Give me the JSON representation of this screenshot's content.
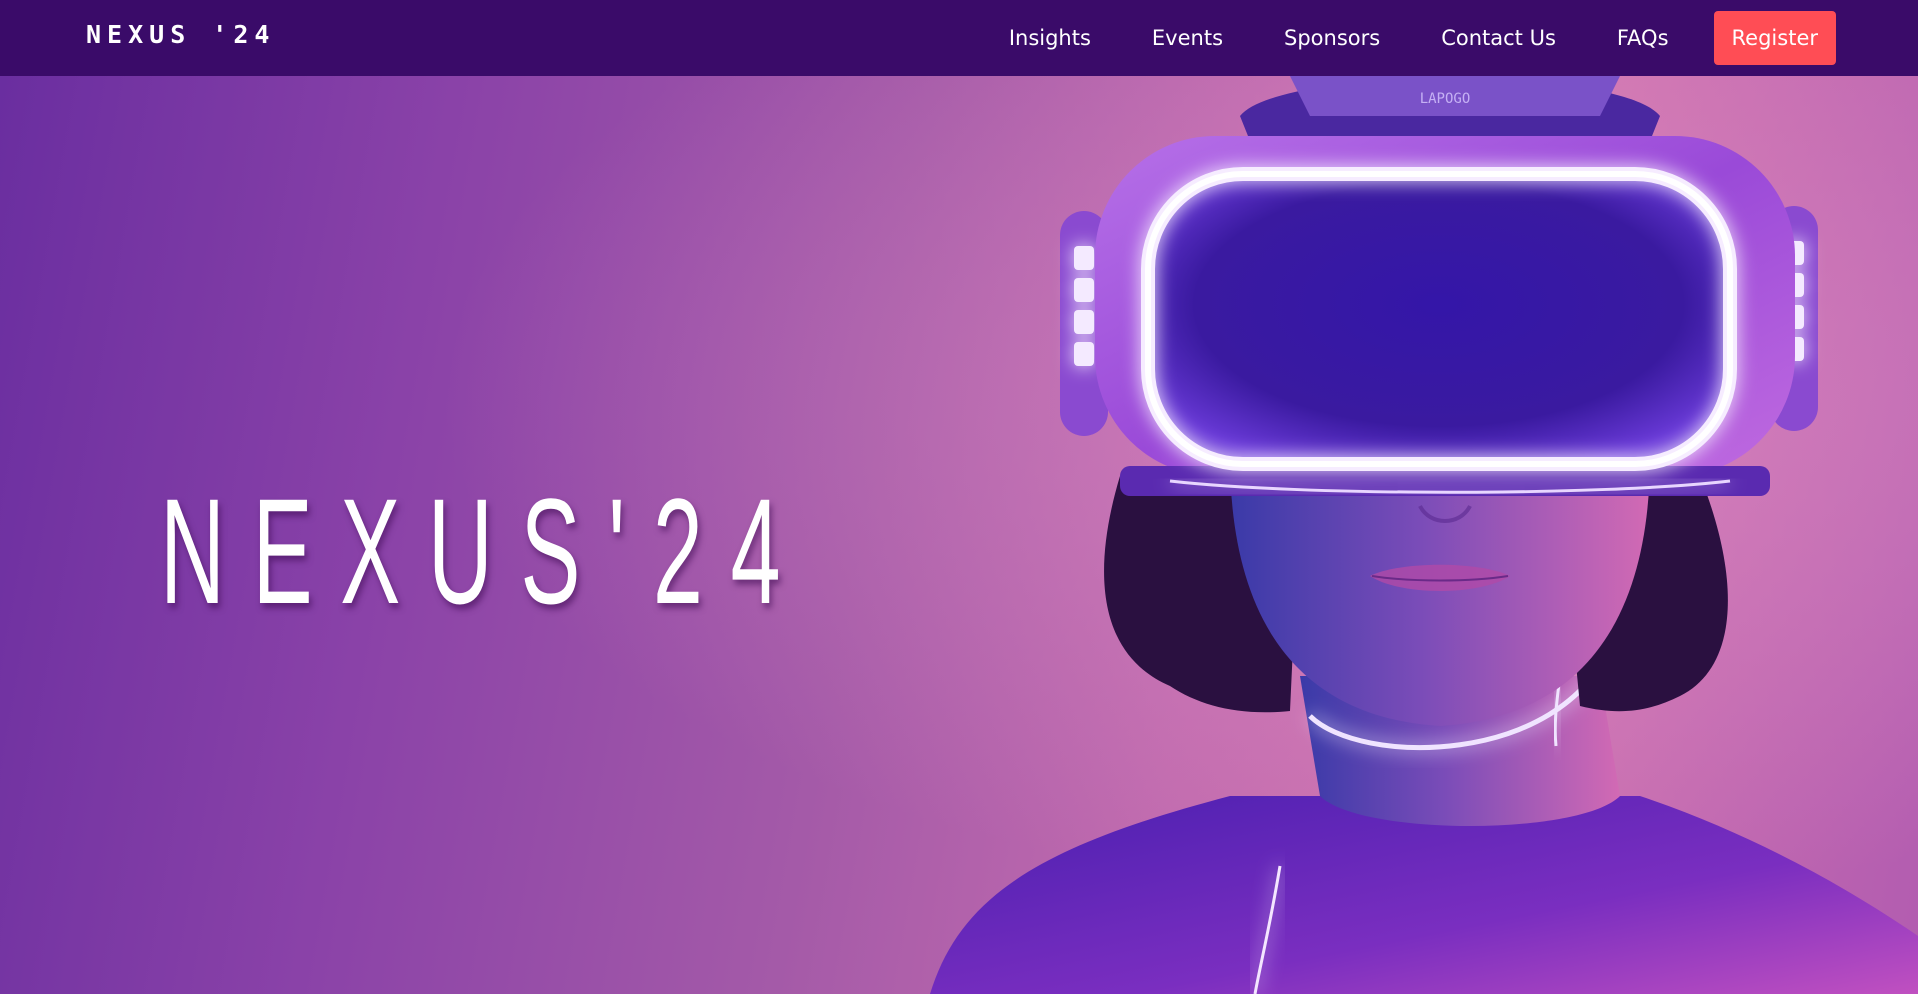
{
  "navbar": {
    "brand": "NEXUS '24",
    "links": [
      {
        "label": "Insights"
      },
      {
        "label": "Events"
      },
      {
        "label": "Sponsors"
      },
      {
        "label": "Contact Us"
      },
      {
        "label": "FAQs"
      }
    ],
    "register_label": "Register"
  },
  "hero": {
    "title": "NEXUS'24",
    "image": "person-wearing-glowing-vr-headset",
    "headset_brand": "LAPOGO"
  },
  "colors": {
    "navbar_bg": "#3a0b69",
    "register_bg": "#ff4d55",
    "hero_gradient_start": "#6a2ea0",
    "hero_gradient_end": "#cf74b0",
    "neon_glow": "#e8d6ff"
  }
}
